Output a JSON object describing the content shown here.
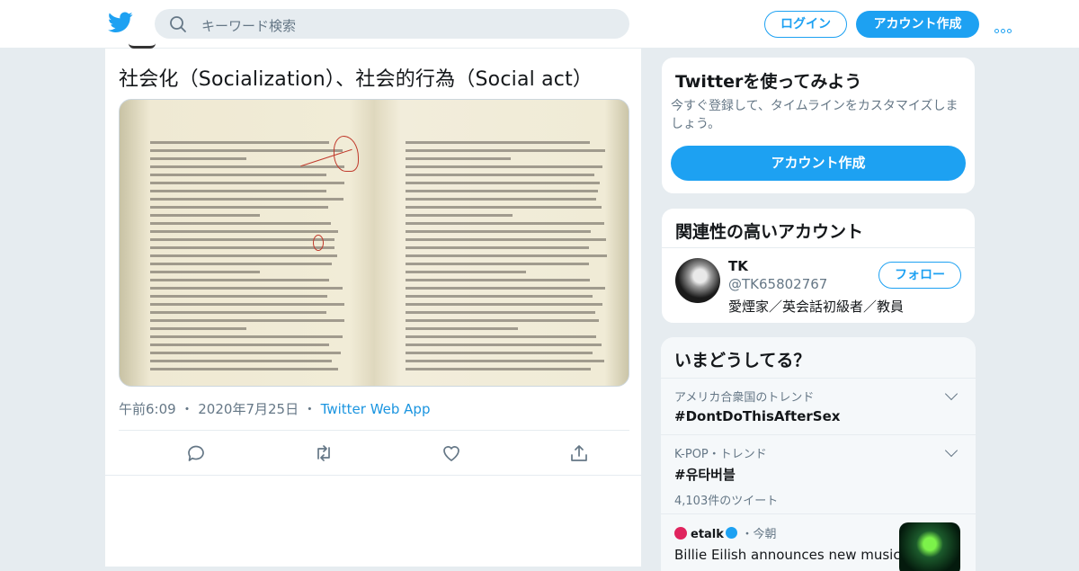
{
  "header": {
    "search_placeholder": "キーワード検索",
    "login_label": "ログイン",
    "signup_label": "アカウント作成"
  },
  "tweet": {
    "text": "社会化（Socialization）、社会的行為（Social act）",
    "time": "午前6:09",
    "date": "2020年7月25日",
    "app": "Twitter Web App"
  },
  "sidebar": {
    "try": {
      "title": "Twitterを使ってみよう",
      "description": "今すぐ登録して、タイムラインをカスタマイズしましょう。",
      "cta": "アカウント作成"
    },
    "related": {
      "title": "関連性の高いアカウント",
      "account": {
        "name": "TK",
        "handle": "@TK65802767",
        "bio": "愛煙家／英会話初級者／教員",
        "follow_label": "フォロー"
      }
    },
    "trends": {
      "title": "いまどうしてる？",
      "items": [
        {
          "context": "アメリカ合衆国のトレンド",
          "topic": "#DontDoThisAfterSex",
          "count": ""
        },
        {
          "context": "K-POP・トレンド",
          "topic": "#유타버블",
          "count": "4,103件のツイート"
        }
      ],
      "news": {
        "source": "etalk",
        "when": "今朝",
        "headline": "Billie Eilish announces new music"
      }
    }
  },
  "colors": {
    "accent": "#1da1f2",
    "text": "#14171a",
    "muted": "#657786",
    "background": "#e6ecf0"
  },
  "icons": {
    "logo": "twitter-bird-icon",
    "search": "search-icon",
    "more": "more-dots-icon",
    "reply": "reply-icon",
    "retweet": "retweet-icon",
    "like": "heart-icon",
    "share": "share-icon",
    "verified": "verified-badge-icon",
    "chevron": "chevron-down-icon"
  }
}
